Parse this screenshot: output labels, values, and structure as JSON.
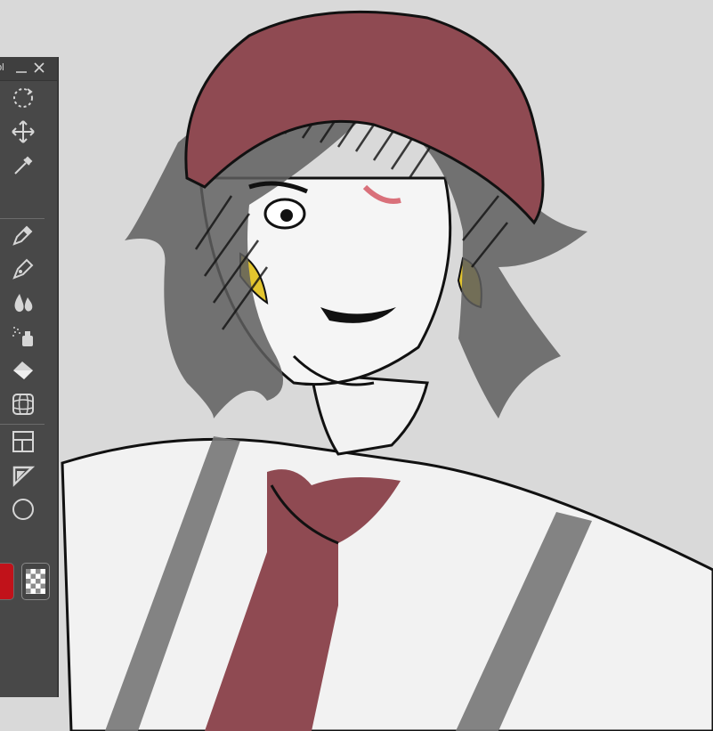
{
  "palette": {
    "title": "ol",
    "tools": [
      {
        "name": "transform-rotate-icon"
      },
      {
        "name": "move-icon"
      },
      {
        "name": "eyedropper-icon"
      },
      {
        "name": "pencil-icon"
      },
      {
        "name": "pen-icon"
      },
      {
        "name": "watercolor-brush-icon"
      },
      {
        "name": "airbrush-icon"
      },
      {
        "name": "fill-bucket-icon"
      },
      {
        "name": "gradient-mesh-icon"
      },
      {
        "name": "frame-border-icon"
      },
      {
        "name": "ruler-triangle-icon"
      },
      {
        "name": "ellipse-figure-icon"
      }
    ],
    "colors": {
      "main": "#c1121a",
      "sub": "transparent",
      "panel_bg": "#484848",
      "icon": "#d6d6d6"
    }
  },
  "canvas": {
    "background": "#d9d9d9"
  }
}
